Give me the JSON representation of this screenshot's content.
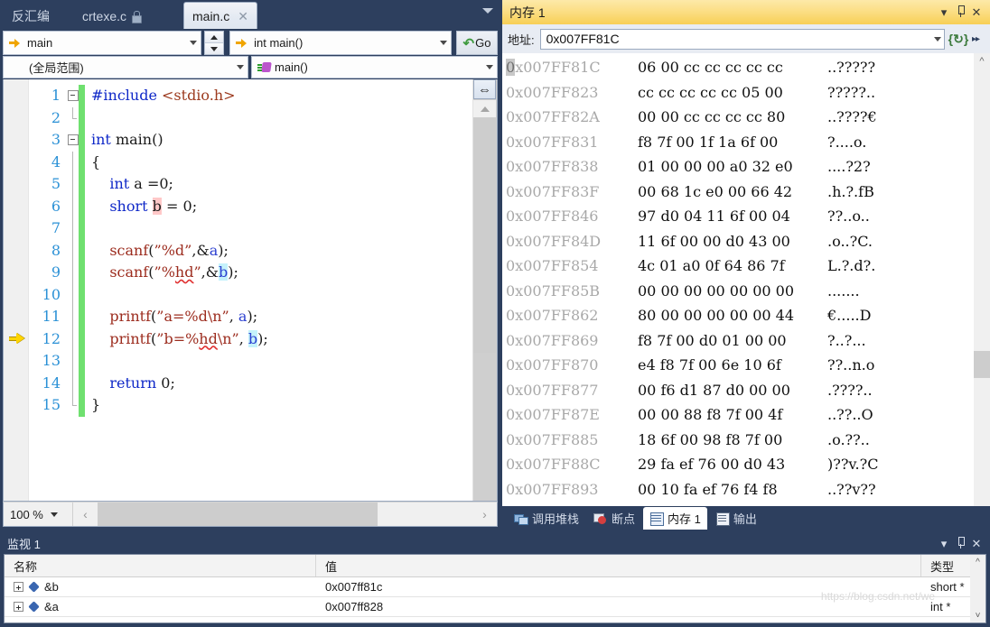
{
  "editor": {
    "tabs": [
      {
        "label": "反汇编",
        "active": false,
        "locked": false,
        "closable": false
      },
      {
        "label": "crtexe.c",
        "active": false,
        "locked": true,
        "closable": false
      },
      {
        "label": "main.c",
        "active": true,
        "locked": false,
        "closable": true
      }
    ],
    "tab_overflow_icon": "chevron-down-icon",
    "navbar": {
      "function_selector": "main",
      "signature_selector": "int main()",
      "go_label": "Go",
      "scope_selector": "(全局范围)",
      "member_selector": "main()"
    },
    "zoom_level": "100 %",
    "code": [
      {
        "n": "1",
        "fold": "box",
        "html": "<span class='t-pre'>#include</span> <span class='t-hdr'>&lt;stdio.h&gt;</span>"
      },
      {
        "n": "2",
        "fold": "vend",
        "html": ""
      },
      {
        "n": "3",
        "fold": "box",
        "html": "<span class='t-kw'>int</span> <span class='t-plain'>main</span><span class='t-plain'>()</span>"
      },
      {
        "n": "4",
        "fold": "vline",
        "html": "<span class='t-plain'>{</span>"
      },
      {
        "n": "5",
        "fold": "vline",
        "html": "    <span class='t-kw'>int</span> <span class='t-plain'>a</span> <span class='t-plain'>=</span><span class='t-num'>0</span><span class='t-plain'>;</span>"
      },
      {
        "n": "6",
        "fold": "vline",
        "html": "    <span class='t-kw'>short</span> <span class='t-plain hl-pink'>b</span> <span class='t-plain'>=</span> <span class='t-num'>0</span><span class='t-plain'>;</span>"
      },
      {
        "n": "7",
        "fold": "vline",
        "html": ""
      },
      {
        "n": "8",
        "fold": "vline",
        "html": "    <span class='t-fn'>scanf</span><span class='t-plain'>(</span><span class='t-str'>&#8221;%d&#8221;</span><span class='t-plain'>,</span><span class='t-plain'>&amp;</span><span class='t-var'>a</span><span class='t-plain'>);</span>"
      },
      {
        "n": "9",
        "fold": "vline",
        "html": "    <span class='t-fn'>scanf</span><span class='t-plain'>(</span><span class='t-str'>&#8221;%<span class='squiggle'>hd</span>&#8221;</span><span class='t-plain'>,</span><span class='t-plain'>&amp;</span><span class='t-var hl-cyan'>b</span><span class='t-plain'>);</span>"
      },
      {
        "n": "10",
        "fold": "vline",
        "html": ""
      },
      {
        "n": "11",
        "fold": "vline",
        "html": "    <span class='t-fn'>printf</span><span class='t-plain'>(</span><span class='t-str'>&#8221;a=%d\\n&#8221;</span><span class='t-plain'>,</span> <span class='t-var'>a</span><span class='t-plain'>);</span>"
      },
      {
        "n": "12",
        "fold": "vline",
        "html": "    <span class='t-fn'>printf</span><span class='t-plain'>(</span><span class='t-str'>&#8221;b=%<span class='squiggle'>hd</span>\\n&#8221;</span><span class='t-plain'>,</span> <span class='t-var hl-cyan'>b</span><span class='t-plain'>);</span>"
      },
      {
        "n": "13",
        "fold": "vline",
        "html": ""
      },
      {
        "n": "14",
        "fold": "vline",
        "html": "    <span class='t-kw'>return</span> <span class='t-num'>0</span><span class='t-plain'>;</span>"
      },
      {
        "n": "15",
        "fold": "vend",
        "html": "<span class='t-plain'>}</span>"
      }
    ],
    "execution_arrow_line": "11"
  },
  "memory": {
    "title": "内存 1",
    "address_label": "地址:",
    "address_value": "0x007FF81C",
    "refresh_icon": "auto-refresh-icon",
    "rows": [
      {
        "addr": "0x007FF81C",
        "hex": "06 00 cc cc cc cc cc",
        "ascii": "..?????"
      },
      {
        "addr": "0x007FF823",
        "hex": "cc cc cc cc cc 05 00",
        "ascii": "?????.."
      },
      {
        "addr": "0x007FF82A",
        "hex": "00 00 cc cc cc cc 80",
        "ascii": "..????€"
      },
      {
        "addr": "0x007FF831",
        "hex": "f8 7f 00 1f 1a 6f 00",
        "ascii": "?....o."
      },
      {
        "addr": "0x007FF838",
        "hex": "01 00 00 00 a0 32 e0",
        "ascii": "....?2?"
      },
      {
        "addr": "0x007FF83F",
        "hex": "00 68 1c e0 00 66 42",
        "ascii": ".h.?.fB"
      },
      {
        "addr": "0x007FF846",
        "hex": "97 d0 04 11 6f 00 04",
        "ascii": "??..o.."
      },
      {
        "addr": "0x007FF84D",
        "hex": "11 6f 00 00 d0 43 00",
        "ascii": ".o..?C."
      },
      {
        "addr": "0x007FF854",
        "hex": "4c 01 a0 0f 64 86 7f",
        "ascii": "L.?.d?."
      },
      {
        "addr": "0x007FF85B",
        "hex": "00 00 00 00 00 00 00",
        "ascii": "......."
      },
      {
        "addr": "0x007FF862",
        "hex": "80 00 00 00 00 00 44",
        "ascii": "€.....D"
      },
      {
        "addr": "0x007FF869",
        "hex": "f8 7f 00 d0 01 00 00",
        "ascii": "?..?..."
      },
      {
        "addr": "0x007FF870",
        "hex": "e4 f8 7f 00 6e 10 6f",
        "ascii": "??..n.o"
      },
      {
        "addr": "0x007FF877",
        "hex": "00 f6 d1 87 d0 00 00",
        "ascii": ".????.."
      },
      {
        "addr": "0x007FF87E",
        "hex": "00 00 88 f8 7f 00 4f",
        "ascii": "..??..O"
      },
      {
        "addr": "0x007FF885",
        "hex": "18 6f 00 98 f8 7f 00",
        "ascii": ".o.??.."
      },
      {
        "addr": "0x007FF88C",
        "hex": "29 fa ef 76 00 d0 43",
        "ascii": ")??v.?C"
      },
      {
        "addr": "0x007FF893",
        "hex": "00 10 fa ef 76 f4 f8",
        "ascii": "..??v??"
      }
    ],
    "tabs": [
      {
        "label": "调用堆栈",
        "icon": "call-stack-icon",
        "active": false
      },
      {
        "label": "断点",
        "icon": "breakpoint-icon",
        "active": false
      },
      {
        "label": "内存 1",
        "icon": "memory-icon",
        "active": true
      },
      {
        "label": "输出",
        "icon": "output-icon",
        "active": false
      }
    ]
  },
  "watch": {
    "title": "监视 1",
    "columns": {
      "name": "名称",
      "value": "值",
      "type": "类型"
    },
    "rows": [
      {
        "name": "&b",
        "value": "0x007ff81c",
        "type": "short *"
      },
      {
        "name": "&a",
        "value": "0x007ff828",
        "type": "int *"
      }
    ],
    "watermark": "https://blog.csdn.net/we"
  },
  "colors": {
    "chrome": "#2d3f5e",
    "active_panel_header": "#fbdc7e",
    "exec_arrow": "#ffd500",
    "change_bar": "#6fe06f",
    "line_number": "#2b91d6",
    "keyword": "#0f28c8",
    "string": "#9c2c1e",
    "highlight_pink": "#ffc8c8",
    "highlight_cyan": "#c5f2fb"
  }
}
